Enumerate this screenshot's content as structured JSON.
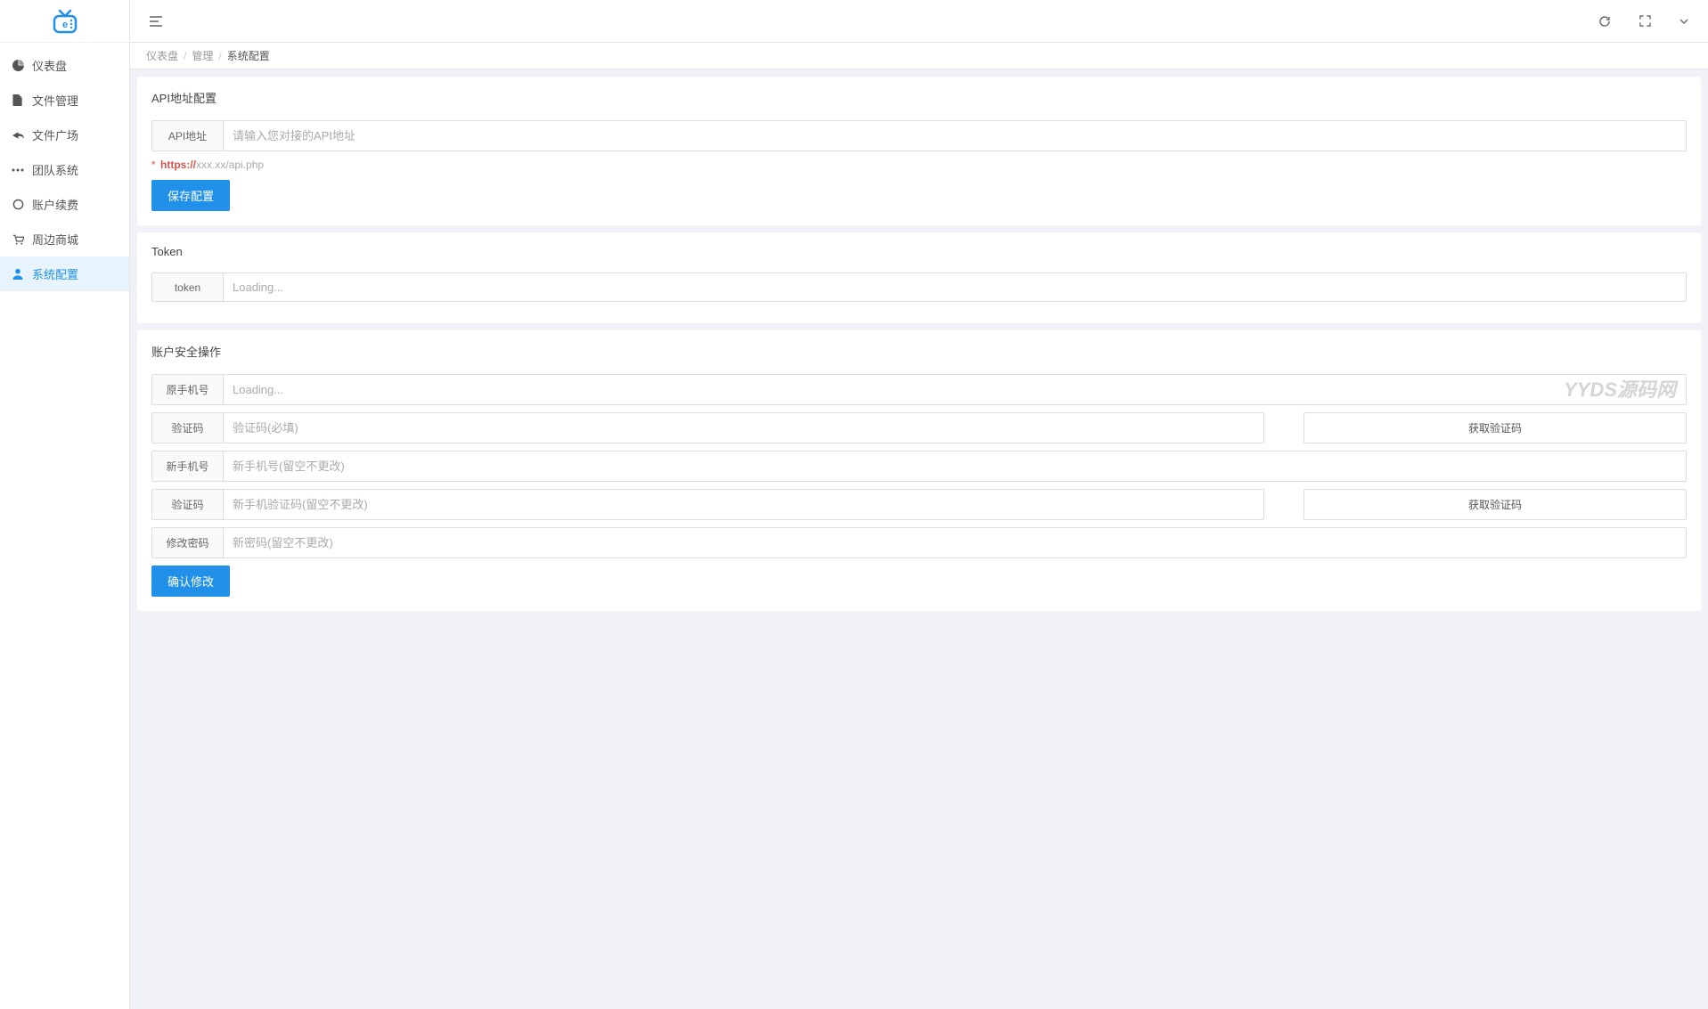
{
  "sidebar": {
    "items": [
      {
        "label": "仪表盘",
        "icon": "dashboard"
      },
      {
        "label": "文件管理",
        "icon": "file"
      },
      {
        "label": "文件广场",
        "icon": "share"
      },
      {
        "label": "团队系统",
        "icon": "team"
      },
      {
        "label": "账户续费",
        "icon": "renew"
      },
      {
        "label": "周边商城",
        "icon": "shop"
      },
      {
        "label": "系统配置",
        "icon": "user"
      }
    ]
  },
  "breadcrumb": {
    "root": "仪表盘",
    "mid": "管理",
    "current": "系统配置"
  },
  "card_api": {
    "title": "API地址配置",
    "label": "API地址",
    "placeholder": "请输入您对接的API地址",
    "hint_prefix": "https://",
    "hint_suffix": "xxx.xx/api.php",
    "save_button": "保存配置"
  },
  "card_token": {
    "title": "Token",
    "label": "token",
    "placeholder": "Loading..."
  },
  "card_security": {
    "title": "账户安全操作",
    "watermark": "YYDS源码网",
    "old_phone_label": "原手机号",
    "old_phone_placeholder": "Loading...",
    "verify_label": "验证码",
    "verify_placeholder": "验证码(必填)",
    "get_code_button": "获取验证码",
    "new_phone_label": "新手机号",
    "new_phone_placeholder": "新手机号(留空不更改)",
    "verify_label2": "验证码",
    "verify_placeholder2": "新手机验证码(留空不更改)",
    "password_label": "修改密码",
    "password_placeholder": "新密码(留空不更改)",
    "confirm_button": "确认修改"
  }
}
